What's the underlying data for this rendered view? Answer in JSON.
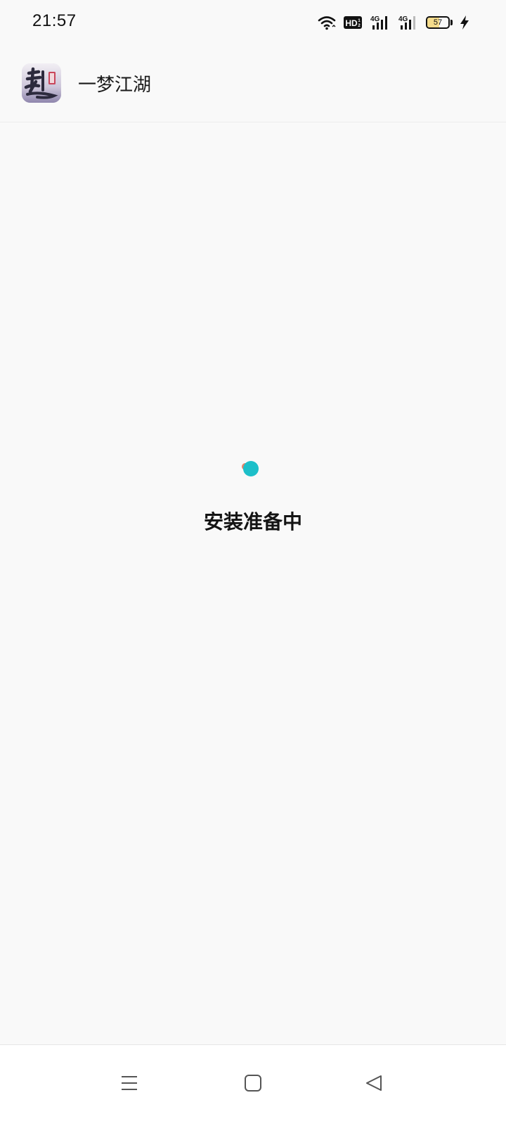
{
  "status_bar": {
    "time": "21:57",
    "network_badge": "HD",
    "sim1_label": "4G",
    "sim2_label": "4G",
    "battery_level": "57",
    "battery_fraction": 0.57,
    "icons": [
      "wifi-icon",
      "hd-icon",
      "signal-4g-icon",
      "signal-4g-icon",
      "battery-icon",
      "charging-icon"
    ]
  },
  "app": {
    "title": "一梦江湖",
    "icon_name": "app-icon"
  },
  "main": {
    "status_message": "安装准备中",
    "spinner_colors": {
      "primary": "#1dbfc9",
      "secondary": "#e5836a"
    }
  },
  "navigation": {
    "buttons": [
      "menu-button",
      "home-button",
      "back-button"
    ]
  }
}
